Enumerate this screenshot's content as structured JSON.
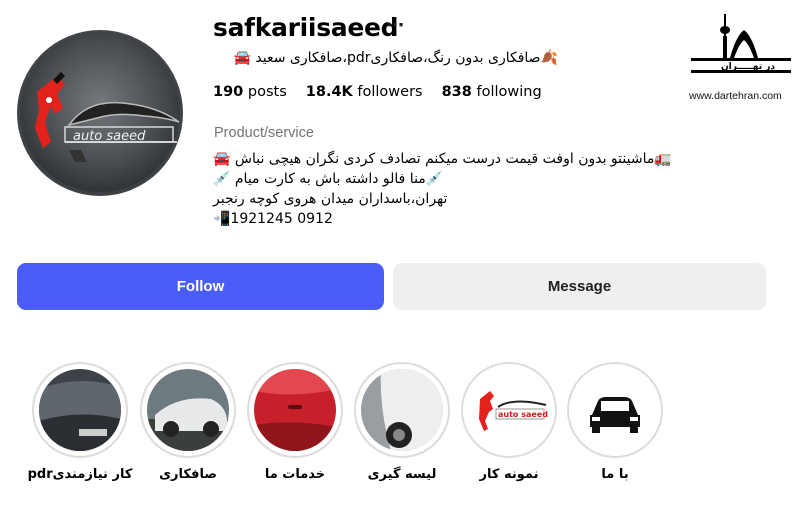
{
  "profile": {
    "username": "safkariisaeed",
    "more_icon": "⋯",
    "bio_headline": "🍂صافکاری بدون رنگ،صافکاریpdr،صافکاری سعید 🚘",
    "stats": {
      "posts_count": "190",
      "posts_label": "posts",
      "followers_count": "18.4K",
      "followers_label": "followers",
      "following_count": "838",
      "following_label": "following"
    },
    "category": "Product/service",
    "bio_lines": [
      "🚛ماشینتو بدون اوفت قیمت درست میکنم تصادف کردی نگران هیچی نباش 🚘",
      "💉منا فالو داشته باش به کارت میام 💉",
      "تهران،باسداران میدان هروی کوچه رنجبر",
      "📲1921245 0912"
    ],
    "avatar_text": "auto saeed"
  },
  "watermark": {
    "title": "در تهـــــران",
    "site": "www.dartehran.com"
  },
  "actions": {
    "follow_label": "Follow",
    "message_label": "Message"
  },
  "highlights": [
    {
      "label": "کار نیازمندیpdr",
      "icon": "car-hood-photo"
    },
    {
      "label": "صافکاری",
      "icon": "damaged-car-photo"
    },
    {
      "label": "خدمات ما",
      "icon": "red-car-door-photo"
    },
    {
      "label": "لیسه گیری",
      "icon": "car-side-photo"
    },
    {
      "label": "نمونه کار",
      "icon": "auto-saeed-logo",
      "logo_text": "auto saeed"
    },
    {
      "label": "با ما",
      "icon": "car-icon"
    }
  ],
  "colors": {
    "follow": "#4a5df9",
    "message": "#efeff2",
    "category": "#737373"
  }
}
